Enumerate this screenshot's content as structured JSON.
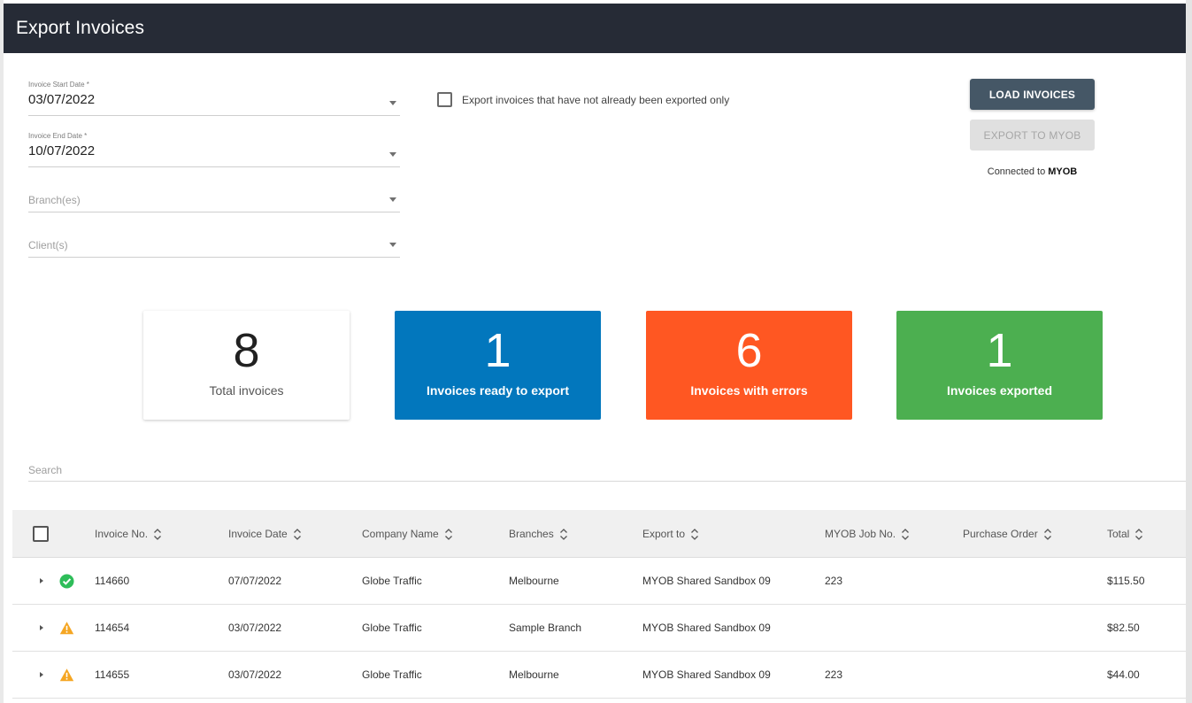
{
  "header": {
    "title": "Export Invoices"
  },
  "filters": {
    "start_date": {
      "label": "Invoice Start Date *",
      "value": "03/07/2022"
    },
    "end_date": {
      "label": "Invoice End Date *",
      "value": "10/07/2022"
    },
    "branches": {
      "placeholder": "Branch(es)"
    },
    "clients": {
      "placeholder": "Client(s)"
    },
    "unexported_only": {
      "label": "Export invoices that have not already been exported only",
      "checked": false
    }
  },
  "actions": {
    "load_label": "LOAD INVOICES",
    "export_label": "EXPORT TO MYOB",
    "connected_prefix": "Connected to",
    "connected_target": "MYOB"
  },
  "stats": {
    "total": {
      "value": "8",
      "label": "Total invoices"
    },
    "ready": {
      "value": "1",
      "label": "Invoices ready to export",
      "color": "#0277bd"
    },
    "errors": {
      "value": "6",
      "label": "Invoices with errors",
      "color": "#ff5722"
    },
    "exported": {
      "value": "1",
      "label": "Invoices exported",
      "color": "#4caf50"
    }
  },
  "search": {
    "placeholder": "Search"
  },
  "table": {
    "columns": [
      "Invoice No.",
      "Invoice Date",
      "Company Name",
      "Branches",
      "Export to",
      "MYOB Job No.",
      "Purchase Order",
      "Total"
    ],
    "rows": [
      {
        "status": "success",
        "invoice_no": "114660",
        "invoice_date": "07/07/2022",
        "company": "Globe Traffic",
        "branch": "Melbourne",
        "export_to": "MYOB Shared Sandbox 09",
        "job_no": "223",
        "po": "",
        "total": "$115.50"
      },
      {
        "status": "warning",
        "invoice_no": "114654",
        "invoice_date": "03/07/2022",
        "company": "Globe Traffic",
        "branch": "Sample Branch",
        "export_to": "MYOB Shared Sandbox 09",
        "job_no": "",
        "po": "",
        "total": "$82.50"
      },
      {
        "status": "warning",
        "invoice_no": "114655",
        "invoice_date": "03/07/2022",
        "company": "Globe Traffic",
        "branch": "Melbourne",
        "export_to": "MYOB Shared Sandbox 09",
        "job_no": "223",
        "po": "",
        "total": "$44.00"
      }
    ]
  }
}
